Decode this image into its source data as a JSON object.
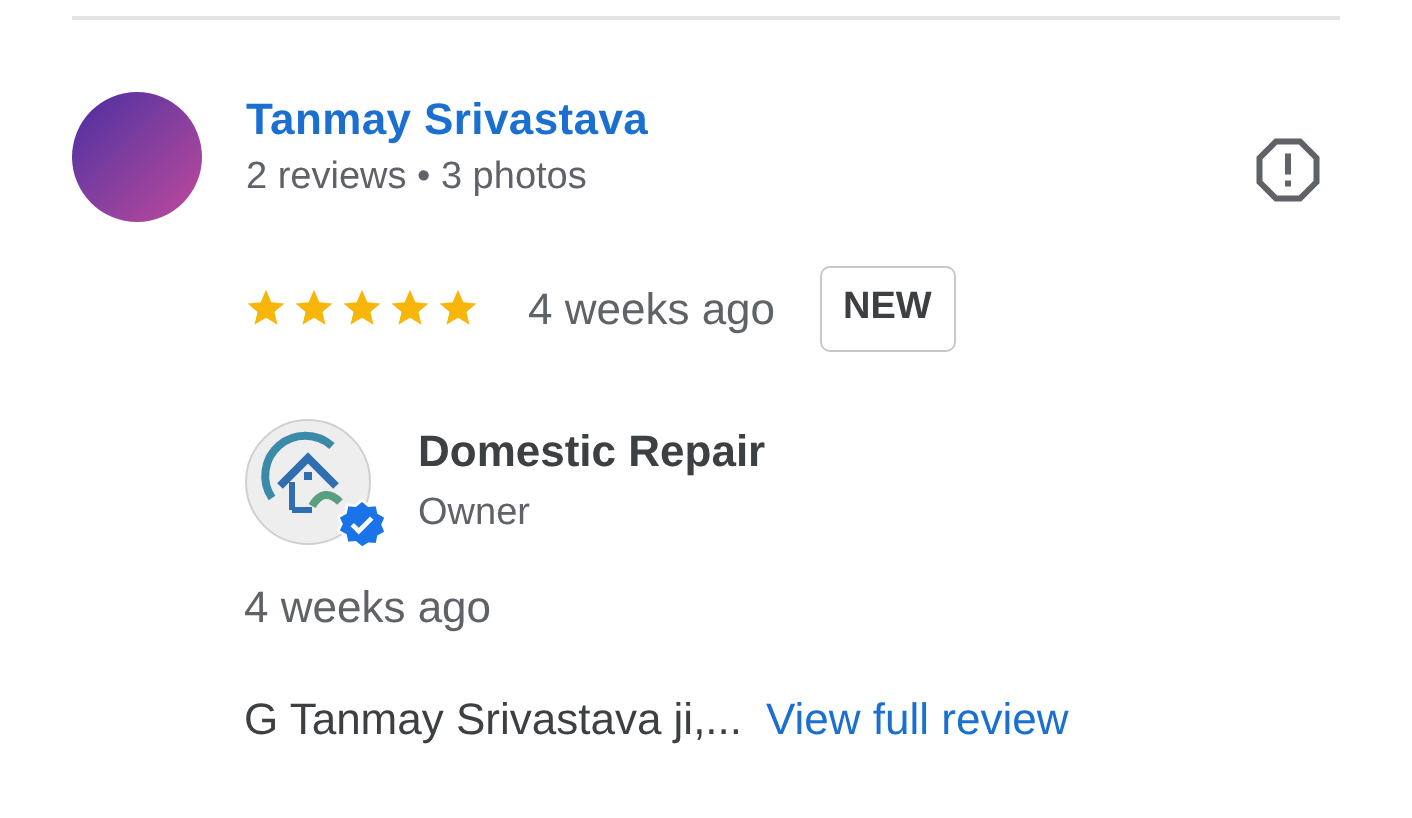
{
  "review": {
    "author": "Tanmay Srivastava",
    "author_stats": "2 reviews • 3 photos",
    "stars": 5,
    "time": "4 weeks ago",
    "badge": "NEW"
  },
  "owner_response": {
    "name": "Domestic Repair",
    "role": "Owner",
    "verified": true,
    "time": "4 weeks ago",
    "excerpt": "G Tanmay Srivastava ji,...",
    "link": "View full review"
  }
}
